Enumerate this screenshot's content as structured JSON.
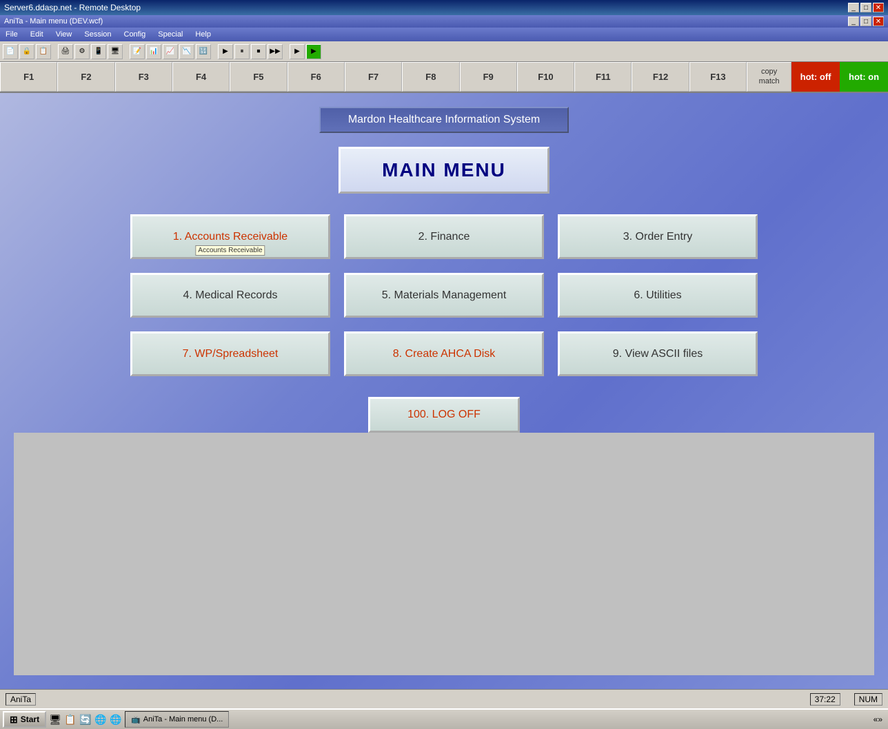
{
  "titlebar": {
    "text": "Server6.ddasp.net - Remote Desktop",
    "controls": [
      "_",
      "□",
      "✕"
    ]
  },
  "menubar": {
    "title": "AniTa - Main menu (DEV.wcf)",
    "items": [
      "File",
      "Edit",
      "View",
      "Session",
      "Config",
      "Special",
      "Help"
    ],
    "controls": [
      "_",
      "□",
      "✕"
    ]
  },
  "fkeys": {
    "keys": [
      "F1",
      "F2",
      "F3",
      "F4",
      "F5",
      "F6",
      "F7",
      "F8",
      "F9",
      "F10",
      "F11",
      "F12",
      "F13"
    ],
    "copy_match": "copy\nmatch",
    "hot_off": "hot: off",
    "hot_on": "hot: on"
  },
  "system": {
    "title": "Mardon Healthcare Information System",
    "menu_title": "MAIN MENU"
  },
  "menu_items": [
    {
      "label": "1. Accounts Receivable",
      "style": "red",
      "tooltip": "Accounts Receivable"
    },
    {
      "label": "2. Finance",
      "style": "dark"
    },
    {
      "label": "3. Order Entry",
      "style": "dark"
    },
    {
      "label": "4. Medical Records",
      "style": "dark"
    },
    {
      "label": "5. Materials Management",
      "style": "dark"
    },
    {
      "label": "6. Utilities",
      "style": "dark"
    },
    {
      "label": "7. WP/Spreadsheet",
      "style": "red"
    },
    {
      "label": "8. Create AHCA Disk",
      "style": "red"
    },
    {
      "label": "9. View ASCII files",
      "style": "dark"
    }
  ],
  "logoff": {
    "label": "100. LOG OFF"
  },
  "statusbar": {
    "left_text": "AniTa",
    "time": "37:22",
    "num": "NUM"
  },
  "taskbar": {
    "start_label": "Start",
    "apps": [
      "AniTa - Main menu (D..."
    ],
    "icons": [
      "🖥",
      "📋",
      "🔄",
      "🌐",
      "🌐"
    ]
  }
}
